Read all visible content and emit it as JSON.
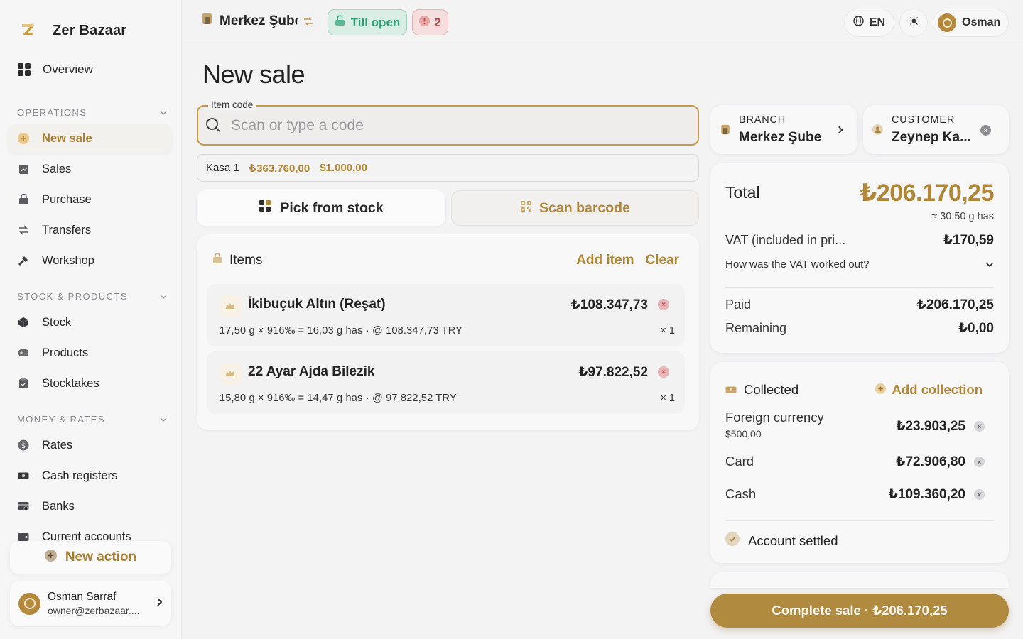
{
  "app": {
    "name": "Zer Bazaar"
  },
  "sidebar": {
    "overview": "Overview",
    "sections": {
      "operations": "OPERATIONS",
      "stock": "STOCK & PRODUCTS",
      "money": "MONEY & RATES"
    },
    "items": {
      "new_sale": "New sale",
      "sales": "Sales",
      "purchase": "Purchase",
      "transfers": "Transfers",
      "workshop": "Workshop",
      "stock": "Stock",
      "products": "Products",
      "stocktakes": "Stocktakes",
      "rates": "Rates",
      "cash_registers": "Cash registers",
      "banks": "Banks",
      "current_accounts": "Current accounts"
    },
    "new_action": "New action",
    "user": {
      "initial": "O",
      "name": "Osman Sarraf",
      "email": "owner@zerbazaar...."
    }
  },
  "topbar": {
    "branch": "Merkez Şube",
    "till": "Till open",
    "alerts_count": "2",
    "lang": "EN",
    "profile_initial": "O",
    "profile_name": "Osman"
  },
  "main": {
    "title": "New sale",
    "code_field": {
      "label": "Item code",
      "placeholder": "Scan or type a code",
      "value": ""
    },
    "kasa": {
      "name": "Kasa 1",
      "try": "₺363.760,00",
      "usd": "$1.000,00"
    },
    "pick_from_stock": "Pick from stock",
    "scan_barcode": "Scan barcode",
    "items": {
      "title": "Items",
      "add_item": "Add item",
      "clear": "Clear",
      "rows": [
        {
          "name": "İkibuçuk Altın (Reşat)",
          "price": "₺108.347,73",
          "detail": "17,50 g × 916‰ = 16,03 g has · @ 108.347,73 TRY",
          "qty": "× 1"
        },
        {
          "name": "22 Ayar Ajda Bilezik",
          "price": "₺97.822,52",
          "detail": "15,80 g × 916‰ = 14,47 g has · @ 97.822,52 TRY",
          "qty": "× 1"
        }
      ]
    }
  },
  "right": {
    "branch": {
      "label": "BRANCH",
      "value": "Merkez Şube"
    },
    "customer": {
      "label": "CUSTOMER",
      "value": "Zeynep Ka..."
    },
    "totals": {
      "total_label": "Total",
      "total_value": "₺206.170,25",
      "has": "≈ 30,50 g has",
      "vat_label": "VAT (included in pri...",
      "vat_value": "₺170,59",
      "vat_question": "How was the VAT worked out?",
      "paid_label": "Paid",
      "paid_value": "₺206.170,25",
      "remaining_label": "Remaining",
      "remaining_value": "₺0,00"
    },
    "collected": {
      "title": "Collected",
      "add": "Add collection",
      "rows": [
        {
          "name": "Foreign currency",
          "sub": "$500,00",
          "value": "₺23.903,25"
        },
        {
          "name": "Card",
          "sub": "",
          "value": "₺72.906,80"
        },
        {
          "name": "Cash",
          "sub": "",
          "value": "₺109.360,20"
        }
      ],
      "settled": "Account settled"
    },
    "complete": "Complete sale · ₺206.170,25"
  },
  "colors": {
    "accent": "#b08637",
    "success": "#2f9d74",
    "danger": "#b84848"
  }
}
